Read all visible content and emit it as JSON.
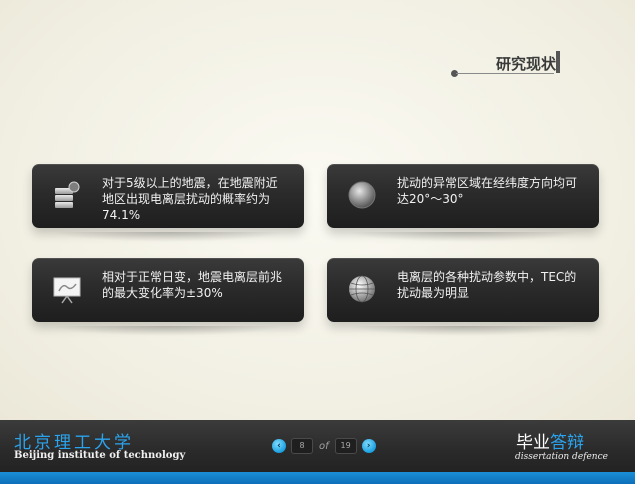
{
  "header": {
    "section_title": "研究现状"
  },
  "cards": [
    {
      "text": "对于5级以上的地震，在地震附近地区出现电离层扰动的概率约为74.1%",
      "icon": "database-icon"
    },
    {
      "text": "扰动的异常区域在经纬度方向均可达20°～30°",
      "icon": "orb-icon"
    },
    {
      "text": "相对于正常日变，地震电离层前兆的最大变化率为±30%",
      "icon": "presentation-board-icon"
    },
    {
      "text": "电离层的各种扰动参数中，TEC的扰动最为明显",
      "icon": "globe-icon"
    }
  ],
  "footer": {
    "university_cn": "北京理工大学",
    "university_en": "Beijing institute of technology",
    "pager": {
      "prev": "‹",
      "current": "8",
      "of": "of",
      "total": "19",
      "next": "›"
    },
    "defense_cn_a": "毕业",
    "defense_cn_b": "答辩",
    "defense_en": "dissertation defence"
  },
  "colors": {
    "accent": "#2aa4ee",
    "card": "#2b2b2b",
    "background": "#f3f1e6"
  }
}
